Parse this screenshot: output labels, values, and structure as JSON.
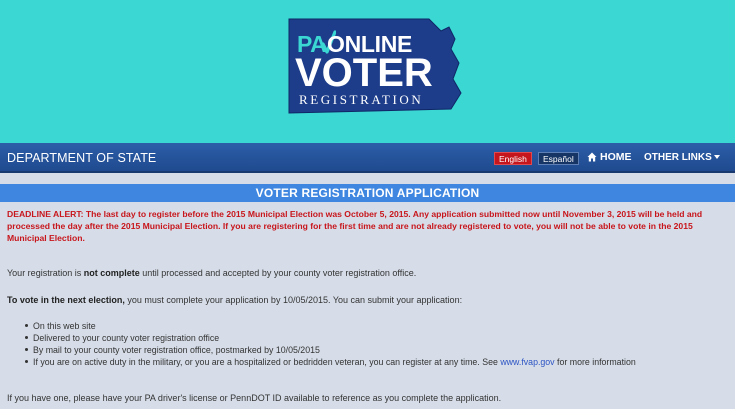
{
  "logo": {
    "pa": "PA",
    "online": "ONLINE",
    "voter": "VOTER",
    "registration": "REGISTRATION"
  },
  "navbar": {
    "department": "DEPARTMENT OF STATE",
    "english": "English",
    "espanol": "Español",
    "home": "HOME",
    "other_links": "OTHER LINKS"
  },
  "section": {
    "title": "VOTER REGISTRATION APPLICATION"
  },
  "content": {
    "alert": "DEADLINE ALERT: The last day to register before the 2015 Municipal Election was October 5, 2015. Any application submitted now until November 3, 2015 will be held and processed the day after the 2015 Municipal Election. If you are registering for the first time and are not already registered to vote, you will not be able to vote in the 2015 Municipal Election.",
    "p1_pre": "Your registration is ",
    "p1_bold": "not complete",
    "p1_post": " until processed and accepted by your county voter registration office.",
    "p2_bold": "To vote in the next election,",
    "p2_post": " you must complete your application by 10/05/2015. You can submit your application:",
    "ways": [
      "On this web site",
      "Delivered to your county voter registration office",
      "By mail to your county voter registration office, postmarked by 10/05/2015"
    ],
    "military_pre": "If you are on active duty in the military, or you are a hospitalized or bedridden veteran, you can register at any time. See ",
    "military_link": "www.fvap.gov",
    "military_post": " for more information",
    "p3": "If you have one, please have your PA driver's license or PennDOT ID available to reference as you complete the application."
  },
  "colors": {
    "banner": "#3ad7d3",
    "logo_fill": "#1d3d8a",
    "navbar": "#2354a0",
    "section_head": "#3e86e0",
    "alert": "#c8151b",
    "link": "#2d54c4"
  }
}
